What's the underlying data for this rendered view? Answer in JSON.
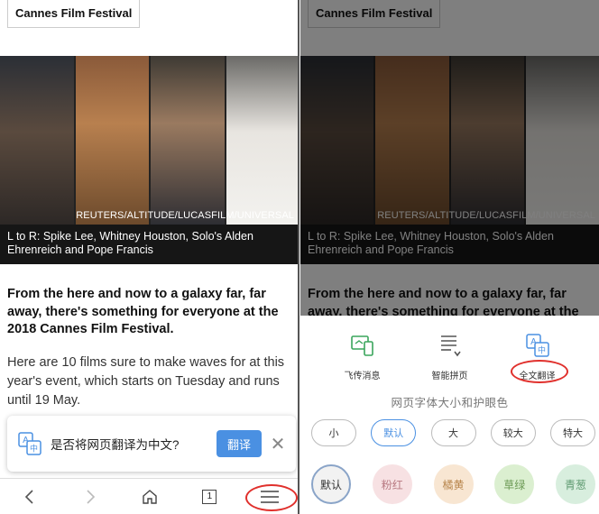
{
  "article": {
    "tag": "Cannes Film Festival",
    "photo_credit": "REUTERS/ALTITUDE/LUCASFILM/UNIVERSAL",
    "caption": "L to R: Spike Lee, Whitney Houston, Solo's Alden Ehrenreich and Pope Francis",
    "lead": "From the here and now to a galaxy far, far away, there's something for everyone at the 2018 Cannes Film Festival.",
    "paragraph": "Here are 10 films sure to make waves for at this year's event, which starts on Tuesday and runs until 19 May."
  },
  "translate_prompt": {
    "text": "是否将网页翻译为中文?",
    "button": "翻译",
    "close": "✕"
  },
  "bottom_nav": {
    "back": "‹",
    "forward": "›",
    "tab_count": "1"
  },
  "sheet": {
    "actions": [
      {
        "label": "飞传消息",
        "icon": "phone-transfer-icon"
      },
      {
        "label": "智能拼页",
        "icon": "smart-page-icon"
      },
      {
        "label": "全文翻译",
        "icon": "translate-icon"
      }
    ],
    "section_title": "网页字体大小和护眼色",
    "font_sizes": [
      "小",
      "默认",
      "大",
      "较大",
      "特大"
    ],
    "selected_font_size": "默认",
    "eye_colors": [
      {
        "label": "默认",
        "color": "#f2f2f2",
        "text": "#333333"
      },
      {
        "label": "粉红",
        "color": "#f7e1e3",
        "text": "#b87a82"
      },
      {
        "label": "橘黄",
        "color": "#f8e6d2",
        "text": "#b8864d"
      },
      {
        "label": "草绿",
        "color": "#dbefd0",
        "text": "#6c9a55"
      },
      {
        "label": "青葱",
        "color": "#d8eede",
        "text": "#5e9a70"
      }
    ],
    "selected_eye_color": "默认"
  },
  "colors": {
    "accent": "#4a90e2",
    "highlight_ring": "#e0302c",
    "dark_overlay": "rgba(0,0,0,0.5)"
  }
}
